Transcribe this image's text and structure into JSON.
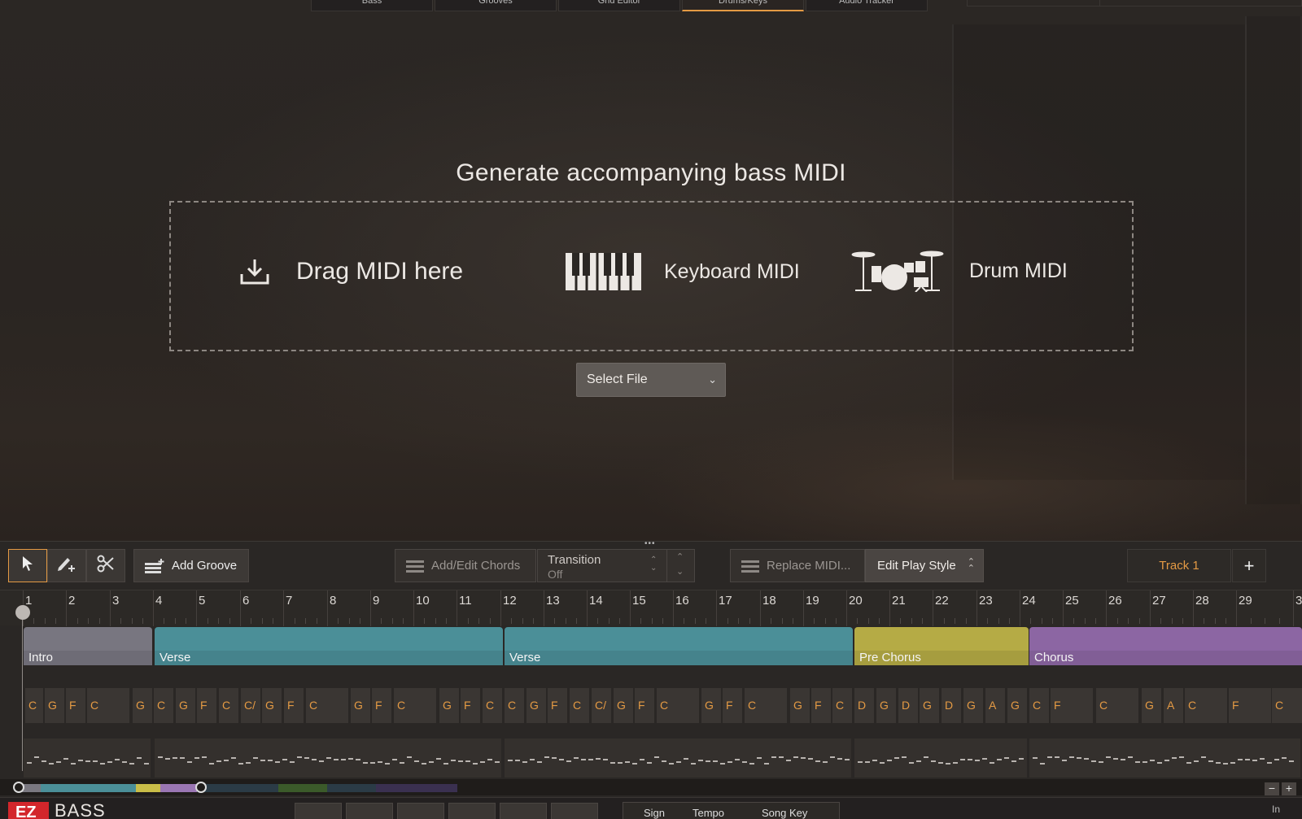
{
  "top_tabs": [
    "Bass",
    "Grooves",
    "Grid Editor",
    "Drums/Keys",
    "Audio Tracker"
  ],
  "generate": {
    "title": "Generate accompanying bass MIDI",
    "drag_label": "Drag MIDI here",
    "keyboard_label": "Keyboard MIDI",
    "drum_label": "Drum MIDI",
    "select_file": "Select File"
  },
  "toolbar": {
    "add_groove": "Add Groove",
    "add_edit_chords": "Add/Edit Chords",
    "transition_label": "Transition",
    "transition_value": "Off",
    "replace_midi": "Replace MIDI...",
    "edit_play_style": "Edit Play Style",
    "track_name": "Track 1",
    "add_track": "+"
  },
  "ruler": {
    "bars": [
      "1",
      "2",
      "3",
      "4",
      "5",
      "6",
      "7",
      "8",
      "9",
      "10",
      "11",
      "12",
      "13",
      "14",
      "15",
      "16",
      "17",
      "18",
      "19",
      "20",
      "21",
      "22",
      "23",
      "24",
      "25",
      "26",
      "27",
      "28",
      "29",
      "3"
    ]
  },
  "sections": [
    {
      "name": "Intro",
      "color": "#787680"
    },
    {
      "name": "Verse",
      "color": "#4b8f98"
    },
    {
      "name": "Verse",
      "color": "#4b8f98"
    },
    {
      "name": "Pre Chorus",
      "color": "#b5ab45"
    },
    {
      "name": "Chorus",
      "color": "#8c66a3"
    }
  ],
  "chords": [
    "C",
    "G",
    "F",
    "C",
    "G",
    "C",
    "G",
    "F",
    "C",
    "C/",
    "G",
    "F",
    "C",
    "G",
    "F",
    "C",
    "G",
    "F",
    "C",
    "C",
    "G",
    "F",
    "C",
    "C/",
    "G",
    "F",
    "C",
    "G",
    "F",
    "C",
    "G",
    "F",
    "C",
    "D",
    "G",
    "D",
    "G",
    "D",
    "G",
    "A",
    "G",
    "C",
    "F",
    "C",
    "G",
    "A",
    "C",
    "F",
    "C"
  ],
  "footer": {
    "logo": "EZ",
    "product": "BASS",
    "sign": "Sign",
    "tempo": "Tempo",
    "song_key": "Song Key",
    "in": "In"
  },
  "colors": {
    "accent": "#e49a44",
    "logo_red": "#d3262b"
  }
}
